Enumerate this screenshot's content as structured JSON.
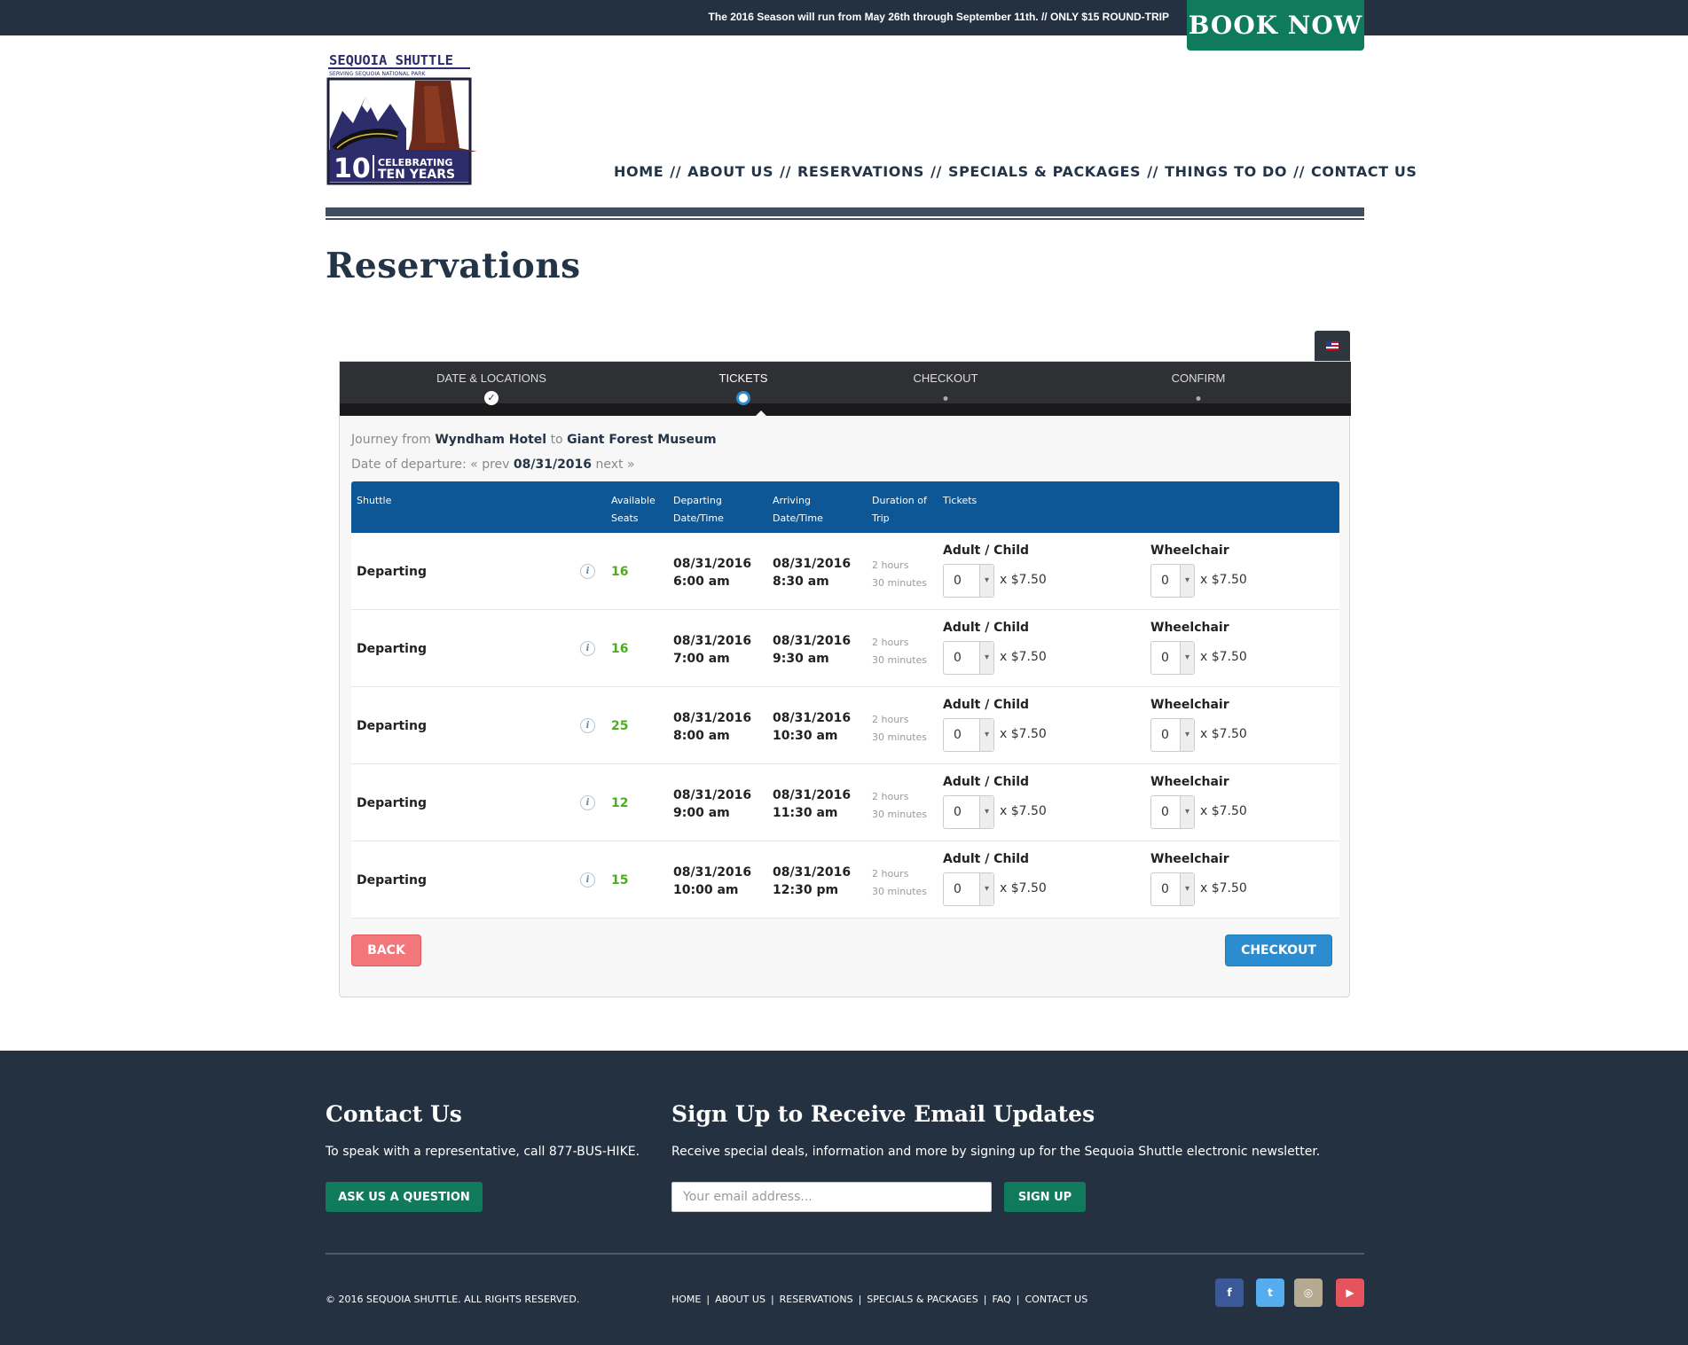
{
  "topbar": {
    "message": "The 2016 Season will run from May 26th through September 11th.  //  ONLY $15 ROUND-TRIP",
    "book_now": "BOOK NOW"
  },
  "logo": {
    "title": "SEQUOIA SHUTTLE",
    "subtitle": "SERVING SEQUOIA NATIONAL PARK",
    "number": "10",
    "celebrating_line1": "CELEBRATING",
    "celebrating_line2": "TEN YEARS"
  },
  "nav": {
    "items": [
      "HOME",
      "ABOUT US",
      "RESERVATIONS",
      "SPECIALS & PACKAGES",
      "THINGS TO DO",
      "CONTACT US"
    ],
    "separator": "//"
  },
  "page": {
    "title": "Reservations"
  },
  "steps": [
    {
      "label": "DATE & LOCATIONS",
      "state": "done"
    },
    {
      "label": "TICKETS",
      "state": "active"
    },
    {
      "label": "CHECKOUT",
      "state": "pending"
    },
    {
      "label": "CONFIRM",
      "state": "pending"
    }
  ],
  "journey": {
    "prefix": "Journey from",
    "from": "Wyndham Hotel",
    "to_word": "to",
    "to": "Giant Forest Museum"
  },
  "departure": {
    "label": "Date of departure:",
    "prev": "« prev",
    "date": "08/31/2016",
    "next": "next »"
  },
  "table": {
    "headers": {
      "shuttle": "Shuttle",
      "seats_1": "Available",
      "seats_2": "Seats",
      "departing_1": "Departing",
      "departing_2": "Date/Time",
      "arriving_1": "Arriving",
      "arriving_2": "Date/Time",
      "duration_1": "Duration of",
      "duration_2": "Trip",
      "tickets": "Tickets"
    },
    "rows": [
      {
        "shuttle": "Departing",
        "info": "i",
        "seats": "16",
        "dep_date": "08/31/2016",
        "dep_time": "6:00 am",
        "arr_date": "08/31/2016",
        "arr_time": "8:30 am",
        "dur_1": "2 hours",
        "dur_2": "30 minutes",
        "adult_label": "Adult / Child",
        "adult_qty": "0",
        "adult_price": "x $7.50",
        "wc_label": "Wheelchair",
        "wc_qty": "0",
        "wc_price": "x $7.50"
      },
      {
        "shuttle": "Departing",
        "info": "i",
        "seats": "16",
        "dep_date": "08/31/2016",
        "dep_time": "7:00 am",
        "arr_date": "08/31/2016",
        "arr_time": "9:30 am",
        "dur_1": "2 hours",
        "dur_2": "30 minutes",
        "adult_label": "Adult / Child",
        "adult_qty": "0",
        "adult_price": "x $7.50",
        "wc_label": "Wheelchair",
        "wc_qty": "0",
        "wc_price": "x $7.50"
      },
      {
        "shuttle": "Departing",
        "info": "i",
        "seats": "25",
        "dep_date": "08/31/2016",
        "dep_time": "8:00 am",
        "arr_date": "08/31/2016",
        "arr_time": "10:30 am",
        "dur_1": "2 hours",
        "dur_2": "30 minutes",
        "adult_label": "Adult / Child",
        "adult_qty": "0",
        "adult_price": "x $7.50",
        "wc_label": "Wheelchair",
        "wc_qty": "0",
        "wc_price": "x $7.50"
      },
      {
        "shuttle": "Departing",
        "info": "i",
        "seats": "12",
        "dep_date": "08/31/2016",
        "dep_time": "9:00 am",
        "arr_date": "08/31/2016",
        "arr_time": "11:30 am",
        "dur_1": "2 hours",
        "dur_2": "30 minutes",
        "adult_label": "Adult / Child",
        "adult_qty": "0",
        "adult_price": "x $7.50",
        "wc_label": "Wheelchair",
        "wc_qty": "0",
        "wc_price": "x $7.50"
      },
      {
        "shuttle": "Departing",
        "info": "i",
        "seats": "15",
        "dep_date": "08/31/2016",
        "dep_time": "10:00 am",
        "arr_date": "08/31/2016",
        "arr_time": "12:30 pm",
        "dur_1": "2 hours",
        "dur_2": "30 minutes",
        "adult_label": "Adult / Child",
        "adult_qty": "0",
        "adult_price": "x $7.50",
        "wc_label": "Wheelchair",
        "wc_qty": "0",
        "wc_price": "x $7.50"
      }
    ]
  },
  "buttons": {
    "back": "BACK",
    "checkout": "CHECKOUT"
  },
  "footer": {
    "contact_title": "Contact Us",
    "contact_text": "To speak with a representative, call 877-BUS-HIKE.",
    "ask_button": "ASK US A QUESTION",
    "signup_title": "Sign Up to Receive Email Updates",
    "signup_text": "Receive special deals, information and more by signing up for the Sequoia Shuttle electronic newsletter.",
    "email_placeholder": "Your email address...",
    "signup_button": "SIGN UP",
    "copyright": "© 2016 SEQUOIA SHUTTLE. ALL RIGHTS RESERVED.",
    "links": [
      "HOME",
      "ABOUT US",
      "RESERVATIONS",
      "SPECIALS & PACKAGES",
      "FAQ",
      "CONTACT US"
    ],
    "link_separator": "|",
    "social": [
      {
        "icon": "facebook-icon",
        "glyph": "f",
        "color": "#3b5998"
      },
      {
        "icon": "twitter-icon",
        "glyph": "t",
        "color": "#55acee"
      },
      {
        "icon": "instagram-icon",
        "glyph": "◎",
        "color": "#b5a991"
      },
      {
        "icon": "youtube-icon",
        "glyph": "▶",
        "color": "#e5545d"
      }
    ]
  },
  "colors": {
    "dark_navy": "#233140",
    "brand_green": "#0f7a5c",
    "table_header_blue": "#0d5796",
    "checkout_blue": "#2b8ccf",
    "back_red": "#f2777a",
    "seats_green": "#4cae1f",
    "hero_cream": "#fbfbe8"
  }
}
